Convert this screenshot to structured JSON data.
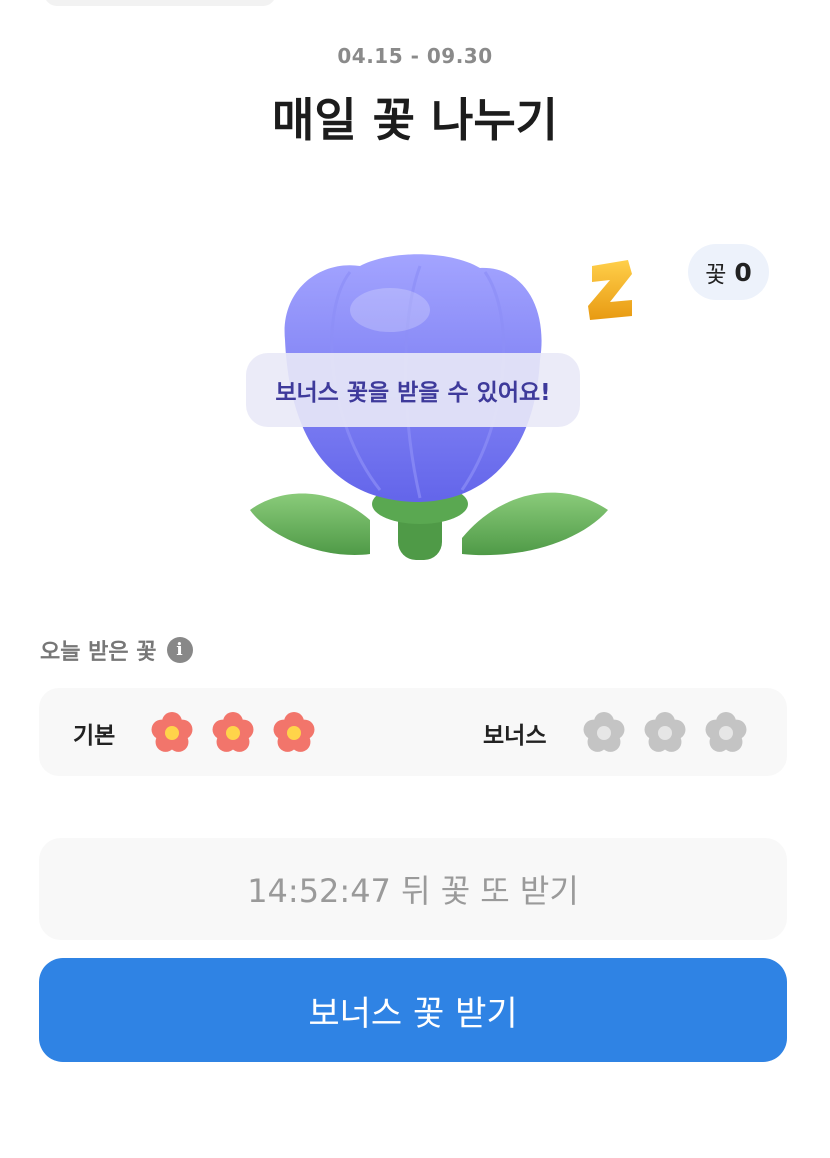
{
  "header": {
    "date_range": "04.15 - 09.30",
    "title": "매일 꽃 나누기"
  },
  "flower_counter": {
    "label": "꽃",
    "value": "0"
  },
  "hero": {
    "bubble_text": "보너스 꽃을 받을 수 있어요!",
    "sleep_letter": "Z",
    "flower_color": "#7276ef"
  },
  "today": {
    "label": "오늘 받은 꽃",
    "info_icon": "info-icon",
    "basic_label": "기본",
    "basic_received": 3,
    "basic_total": 3,
    "bonus_label": "보너스",
    "bonus_received": 0,
    "bonus_total": 3,
    "received_color": "#f2756b",
    "empty_color": "#c4c4c4"
  },
  "timer": {
    "text": "14:52:47 뒤 꽃 또 받기"
  },
  "cta": {
    "label": "보너스 꽃 받기",
    "color": "#2f83e4"
  }
}
